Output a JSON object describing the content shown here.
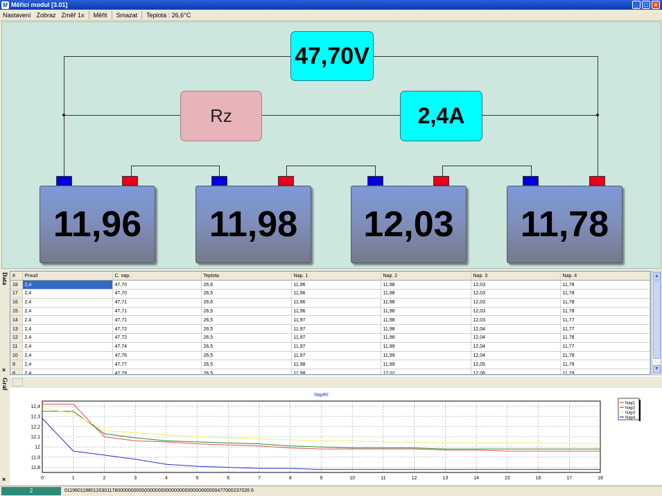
{
  "window": {
    "title": "Měřící modul [3.01]",
    "icon_label": "M",
    "min_glyph": "_",
    "max_glyph": "□",
    "close_glyph": "×"
  },
  "menu": {
    "items": [
      "Nastavení",
      "Zobraz",
      "Změř 1x",
      "Měřit",
      "Smazat"
    ],
    "temperature": "Teplota :  26,6°C"
  },
  "diagram": {
    "total_voltage": "47,70V",
    "resistor_label": "Rz",
    "current": "2,4A",
    "batteries": [
      "11,96",
      "11,98",
      "12,03",
      "11,78"
    ],
    "colors": {
      "display": "#00ffff",
      "resistor": "#e6b4b9",
      "terminal_negative": "#0000dd",
      "terminal_positive": "#e8001a",
      "background": "#cde7df"
    }
  },
  "sidebar": {
    "data_label": "Data",
    "graph_label": "Graf",
    "close_glyph": "×"
  },
  "table": {
    "columns": [
      "#",
      "Proud",
      "C. nap.",
      "Teplota",
      "Nap. 1",
      "Nap. 2",
      "Nap. 3",
      "Nap. 4"
    ],
    "rows": [
      [
        "18",
        "2,4",
        "47,70",
        "26,6",
        "11,96",
        "11,98",
        "12,03",
        "11,78"
      ],
      [
        "17",
        "2,4",
        "47,70",
        "26,5",
        "11,96",
        "11,98",
        "12,03",
        "11,78"
      ],
      [
        "16",
        "2,4",
        "47,71",
        "26,6",
        "11,96",
        "11,98",
        "12,03",
        "11,78"
      ],
      [
        "15",
        "2,4",
        "47,71",
        "26,5",
        "11,96",
        "11,98",
        "12,03",
        "11,78"
      ],
      [
        "14",
        "2,4",
        "47,71",
        "26,5",
        "11,97",
        "11,98",
        "12,03",
        "11,77"
      ],
      [
        "13",
        "2,4",
        "47,72",
        "26,5",
        "11,97",
        "11,98",
        "12,04",
        "11,77"
      ],
      [
        "12",
        "2,4",
        "47,72",
        "26,5",
        "11,97",
        "11,98",
        "12,04",
        "11,78"
      ],
      [
        "11",
        "2,4",
        "47,74",
        "26,5",
        "11,97",
        "11,99",
        "12,04",
        "11,77"
      ],
      [
        "10",
        "2,4",
        "47,76",
        "26,5",
        "11,97",
        "11,99",
        "12,04",
        "11,78"
      ],
      [
        "9",
        "2,4",
        "47,77",
        "26,5",
        "11,98",
        "11,99",
        "12,05",
        "11,79"
      ],
      [
        "8",
        "2,4",
        "47,79",
        "26,5",
        "11,98",
        "12,01",
        "12,06",
        "11,79"
      ]
    ],
    "scroll_up": "▲",
    "scroll_down": "▼"
  },
  "chart_data": {
    "type": "line",
    "title": "Napětí",
    "xlabel": "",
    "ylabel": "",
    "x": [
      0,
      1,
      2,
      3,
      4,
      5,
      6,
      7,
      8,
      9,
      10,
      11,
      12,
      13,
      14,
      15,
      16,
      17,
      18
    ],
    "xlim": [
      0,
      18
    ],
    "ylim": [
      11.75,
      12.45
    ],
    "yticks": [
      11.8,
      11.9,
      12.0,
      12.1,
      12.2,
      12.3,
      12.4
    ],
    "ytick_labels": [
      "11,8",
      "11,9",
      "12",
      "12,1",
      "12,2",
      "12,3",
      "12,4"
    ],
    "grid": true,
    "legend": "top-right",
    "series": [
      {
        "name": "Nap1",
        "color": "#e05050",
        "values": [
          12.42,
          12.42,
          12.1,
          12.06,
          12.05,
          12.03,
          12.02,
          12.01,
          11.99,
          11.98,
          11.98,
          11.98,
          11.98,
          11.97,
          11.97,
          11.96,
          11.96,
          11.96,
          11.96
        ]
      },
      {
        "name": "Nap2",
        "color": "#2a8a2a",
        "values": [
          12.35,
          12.35,
          12.13,
          12.09,
          12.06,
          12.05,
          12.04,
          12.03,
          12.01,
          12.0,
          11.99,
          11.99,
          11.99,
          11.98,
          11.98,
          11.98,
          11.98,
          11.98,
          11.98
        ]
      },
      {
        "name": "Nap3",
        "color": "#f0f060",
        "values": [
          12.38,
          12.33,
          12.16,
          12.14,
          12.12,
          12.1,
          12.09,
          12.08,
          12.07,
          12.06,
          12.06,
          12.05,
          12.05,
          12.04,
          12.04,
          12.04,
          12.04,
          12.03,
          12.03
        ]
      },
      {
        "name": "Nap4",
        "color": "#2030d0",
        "values": [
          12.28,
          11.96,
          11.92,
          11.88,
          11.83,
          11.81,
          11.8,
          11.79,
          11.79,
          11.78,
          11.78,
          11.78,
          11.78,
          11.78,
          11.78,
          11.78,
          11.78,
          11.78,
          11.78
        ]
      }
    ]
  },
  "status": {
    "panel1": "2",
    "panel2": "011960119801203011780000000000000000000000000000000000000477000237026 6"
  }
}
